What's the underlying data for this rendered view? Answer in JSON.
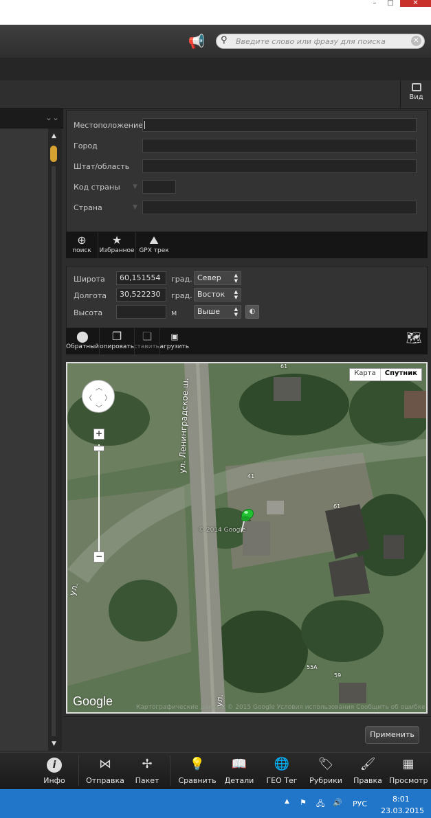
{
  "window": {
    "minimize": "–",
    "maximize": "□",
    "close": "✕"
  },
  "search": {
    "placeholder": "Введите слово или фразу для поиска"
  },
  "view_button": {
    "label": "Вид"
  },
  "location": {
    "fields": [
      {
        "label": "Местоположение",
        "value": ""
      },
      {
        "label": "Город",
        "value": ""
      },
      {
        "label": "Штат/область",
        "value": ""
      },
      {
        "label": "Код страны",
        "value": ""
      },
      {
        "label": "Страна",
        "value": ""
      }
    ],
    "tools": [
      {
        "label": "поиск",
        "icon": "crosshair-icon"
      },
      {
        "label": "Избранное",
        "icon": "star-icon"
      },
      {
        "label": "GPX трек",
        "icon": "hiker-icon"
      }
    ]
  },
  "coords": {
    "latitude_label": "Широта",
    "latitude_value": "60,151554",
    "longitude_label": "Долгота",
    "longitude_value": "30,522230",
    "altitude_label": "Высота",
    "altitude_value": "",
    "unit_deg": "град.",
    "unit_m": "м",
    "lat_dir": "Север",
    "lon_dir": "Восток",
    "alt_dir": "Выше",
    "tools": [
      {
        "label": "Обратный",
        "icon": "pin-icon"
      },
      {
        "label": "Копировать",
        "icon": "copy-icon"
      },
      {
        "label": "Вставить",
        "icon": "paste-icon"
      },
      {
        "label": "Загрузить",
        "icon": "image-icon"
      }
    ]
  },
  "map": {
    "type_map": "Карта",
    "type_satellite": "Спутник",
    "road_label": "ул. Ленинградское ш.",
    "road_label_2": "ул.",
    "road_label_3": "ул.",
    "logo": "Google",
    "attribution": "Картографические данные © 2015 Google   Условия использования   Сообщить об ошибке на карте",
    "watermark": "© 2014 Google",
    "numbers": [
      "61",
      "61",
      "59",
      "55A",
      "41"
    ]
  },
  "apply_label": "Применить",
  "bottom_toolbar": [
    {
      "label": "Инфо",
      "icon": "info-icon"
    },
    {
      "label": "Отправка",
      "icon": "share-icon"
    },
    {
      "label": "Пакет",
      "icon": "batch-icon"
    },
    {
      "label": "Сравнить",
      "icon": "bulb-icon"
    },
    {
      "label": "Детали",
      "icon": "book-icon"
    },
    {
      "label": "ГЕО Тег",
      "icon": "globe-icon"
    },
    {
      "label": "Рубрики",
      "icon": "tag-icon"
    },
    {
      "label": "Правка",
      "icon": "brush-icon"
    },
    {
      "label": "Просмотр",
      "icon": "slideshow-icon"
    }
  ],
  "taskbar": {
    "language": "РУС",
    "time": "8:01",
    "date": "23.03.2015"
  }
}
